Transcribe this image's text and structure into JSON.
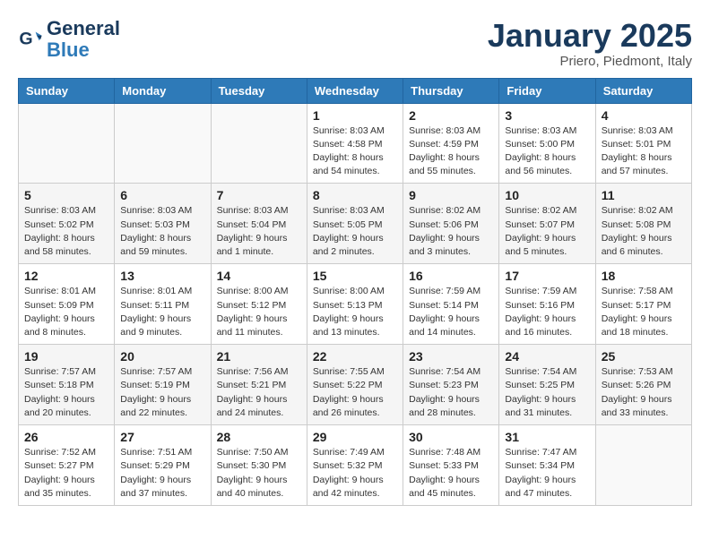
{
  "logo": {
    "text_general": "General",
    "text_blue": "Blue"
  },
  "title": "January 2025",
  "subtitle": "Priero, Piedmont, Italy",
  "days_of_week": [
    "Sunday",
    "Monday",
    "Tuesday",
    "Wednesday",
    "Thursday",
    "Friday",
    "Saturday"
  ],
  "weeks": [
    [
      {
        "day": "",
        "info": ""
      },
      {
        "day": "",
        "info": ""
      },
      {
        "day": "",
        "info": ""
      },
      {
        "day": "1",
        "info": "Sunrise: 8:03 AM\nSunset: 4:58 PM\nDaylight: 8 hours\nand 54 minutes."
      },
      {
        "day": "2",
        "info": "Sunrise: 8:03 AM\nSunset: 4:59 PM\nDaylight: 8 hours\nand 55 minutes."
      },
      {
        "day": "3",
        "info": "Sunrise: 8:03 AM\nSunset: 5:00 PM\nDaylight: 8 hours\nand 56 minutes."
      },
      {
        "day": "4",
        "info": "Sunrise: 8:03 AM\nSunset: 5:01 PM\nDaylight: 8 hours\nand 57 minutes."
      }
    ],
    [
      {
        "day": "5",
        "info": "Sunrise: 8:03 AM\nSunset: 5:02 PM\nDaylight: 8 hours\nand 58 minutes."
      },
      {
        "day": "6",
        "info": "Sunrise: 8:03 AM\nSunset: 5:03 PM\nDaylight: 8 hours\nand 59 minutes."
      },
      {
        "day": "7",
        "info": "Sunrise: 8:03 AM\nSunset: 5:04 PM\nDaylight: 9 hours\nand 1 minute."
      },
      {
        "day": "8",
        "info": "Sunrise: 8:03 AM\nSunset: 5:05 PM\nDaylight: 9 hours\nand 2 minutes."
      },
      {
        "day": "9",
        "info": "Sunrise: 8:02 AM\nSunset: 5:06 PM\nDaylight: 9 hours\nand 3 minutes."
      },
      {
        "day": "10",
        "info": "Sunrise: 8:02 AM\nSunset: 5:07 PM\nDaylight: 9 hours\nand 5 minutes."
      },
      {
        "day": "11",
        "info": "Sunrise: 8:02 AM\nSunset: 5:08 PM\nDaylight: 9 hours\nand 6 minutes."
      }
    ],
    [
      {
        "day": "12",
        "info": "Sunrise: 8:01 AM\nSunset: 5:09 PM\nDaylight: 9 hours\nand 8 minutes."
      },
      {
        "day": "13",
        "info": "Sunrise: 8:01 AM\nSunset: 5:11 PM\nDaylight: 9 hours\nand 9 minutes."
      },
      {
        "day": "14",
        "info": "Sunrise: 8:00 AM\nSunset: 5:12 PM\nDaylight: 9 hours\nand 11 minutes."
      },
      {
        "day": "15",
        "info": "Sunrise: 8:00 AM\nSunset: 5:13 PM\nDaylight: 9 hours\nand 13 minutes."
      },
      {
        "day": "16",
        "info": "Sunrise: 7:59 AM\nSunset: 5:14 PM\nDaylight: 9 hours\nand 14 minutes."
      },
      {
        "day": "17",
        "info": "Sunrise: 7:59 AM\nSunset: 5:16 PM\nDaylight: 9 hours\nand 16 minutes."
      },
      {
        "day": "18",
        "info": "Sunrise: 7:58 AM\nSunset: 5:17 PM\nDaylight: 9 hours\nand 18 minutes."
      }
    ],
    [
      {
        "day": "19",
        "info": "Sunrise: 7:57 AM\nSunset: 5:18 PM\nDaylight: 9 hours\nand 20 minutes."
      },
      {
        "day": "20",
        "info": "Sunrise: 7:57 AM\nSunset: 5:19 PM\nDaylight: 9 hours\nand 22 minutes."
      },
      {
        "day": "21",
        "info": "Sunrise: 7:56 AM\nSunset: 5:21 PM\nDaylight: 9 hours\nand 24 minutes."
      },
      {
        "day": "22",
        "info": "Sunrise: 7:55 AM\nSunset: 5:22 PM\nDaylight: 9 hours\nand 26 minutes."
      },
      {
        "day": "23",
        "info": "Sunrise: 7:54 AM\nSunset: 5:23 PM\nDaylight: 9 hours\nand 28 minutes."
      },
      {
        "day": "24",
        "info": "Sunrise: 7:54 AM\nSunset: 5:25 PM\nDaylight: 9 hours\nand 31 minutes."
      },
      {
        "day": "25",
        "info": "Sunrise: 7:53 AM\nSunset: 5:26 PM\nDaylight: 9 hours\nand 33 minutes."
      }
    ],
    [
      {
        "day": "26",
        "info": "Sunrise: 7:52 AM\nSunset: 5:27 PM\nDaylight: 9 hours\nand 35 minutes."
      },
      {
        "day": "27",
        "info": "Sunrise: 7:51 AM\nSunset: 5:29 PM\nDaylight: 9 hours\nand 37 minutes."
      },
      {
        "day": "28",
        "info": "Sunrise: 7:50 AM\nSunset: 5:30 PM\nDaylight: 9 hours\nand 40 minutes."
      },
      {
        "day": "29",
        "info": "Sunrise: 7:49 AM\nSunset: 5:32 PM\nDaylight: 9 hours\nand 42 minutes."
      },
      {
        "day": "30",
        "info": "Sunrise: 7:48 AM\nSunset: 5:33 PM\nDaylight: 9 hours\nand 45 minutes."
      },
      {
        "day": "31",
        "info": "Sunrise: 7:47 AM\nSunset: 5:34 PM\nDaylight: 9 hours\nand 47 minutes."
      },
      {
        "day": "",
        "info": ""
      }
    ]
  ]
}
